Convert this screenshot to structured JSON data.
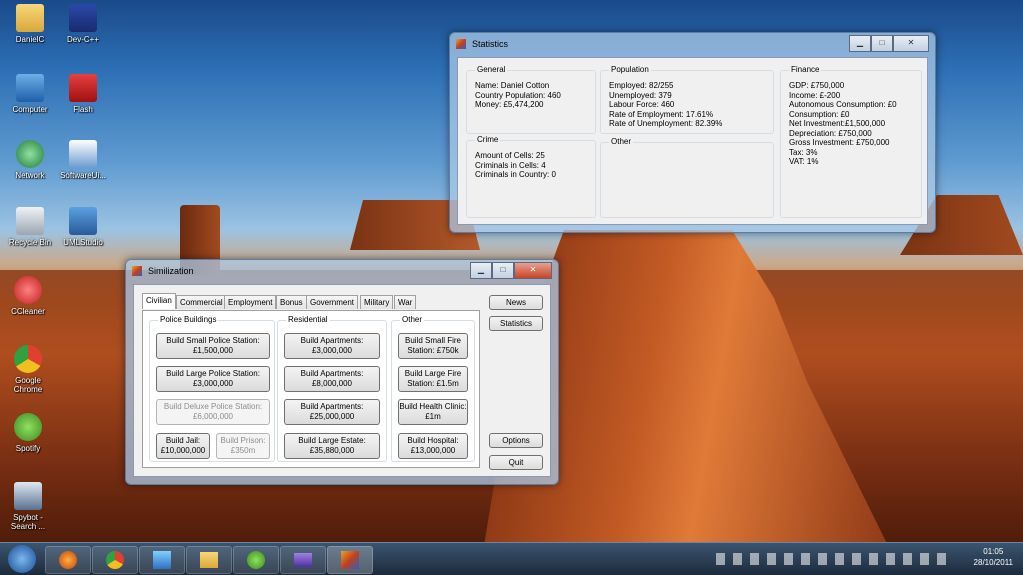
{
  "desktop": {
    "icons": [
      {
        "label": "DanielC"
      },
      {
        "label": "Dev-C++"
      },
      {
        "label": "Computer"
      },
      {
        "label": "Flash"
      },
      {
        "label": "Network"
      },
      {
        "label": "SoftwareUi..."
      },
      {
        "label": "Recycle Bin"
      },
      {
        "label": "UMLStudio"
      },
      {
        "label": "CCleaner"
      },
      {
        "label": "Google Chrome"
      },
      {
        "label": "Spotify"
      },
      {
        "label": "Spybot - Search ..."
      }
    ]
  },
  "statistics": {
    "title": "Statistics",
    "general": {
      "legend": "General",
      "lines": [
        "Name:  Daniel Cotton",
        "Country Population:  460",
        "Money: £5,474,200"
      ]
    },
    "population": {
      "legend": "Population",
      "lines": [
        "Employed:  82/255",
        "Unemployed: 379",
        "Labour Force:  460",
        "Rate of Employment:  17.61%",
        "Rate of Unemployment:  82.39%"
      ]
    },
    "finance": {
      "legend": "Finance",
      "lines": [
        "GDP:  £750,000",
        "Income:  £-200",
        "Autonomous Consumption: £0",
        "Consumption:  £0",
        "Net Investment:£1,500,000",
        "Depreciation:  £750,000",
        "Gross Investment:  £750,000",
        "Tax:  3%",
        "VAT:  1%"
      ]
    },
    "crime": {
      "legend": "Crime",
      "lines": [
        "Amount of Cells: 25",
        "Criminals in Cells: 4",
        "Criminals in Country: 0"
      ]
    },
    "other": {
      "legend": "Other"
    }
  },
  "similization": {
    "title": "Similization",
    "tabs": [
      "Civilian",
      "Commercial",
      "Employment",
      "Bonus",
      "Government",
      "Military",
      "War"
    ],
    "police": {
      "legend": "Police Buildings",
      "small": "Build Small Police Station: £1,500,000",
      "large": "Build Large Police Station: £3,000,000",
      "deluxe": "Build Deluxe Police Station: £6,000,000",
      "jail": "Build Jail: £10,000,000",
      "prison": "Build Prison: £350m"
    },
    "residential": {
      "legend": "Residential",
      "apt1": "Build Apartments: £3,000,000",
      "apt2": "Build Apartments: £8,000,000",
      "apt3": "Build Apartments: £25,000,000",
      "estate": "Build Large Estate: £35,880,000"
    },
    "other": {
      "legend": "Other",
      "smallfire": "Build Small Fire Station: £750k",
      "largefire": "Build Large Fire Station: £1.5m",
      "clinic": "Build Health Clinic: £1m",
      "hospital": "Build Hospital: £13,000,000"
    },
    "side": {
      "news": "News",
      "statistics": "Statistics",
      "options": "Options",
      "quit": "Quit"
    }
  },
  "taskbar": {
    "time": "01:05",
    "date": "28/10/2011"
  }
}
